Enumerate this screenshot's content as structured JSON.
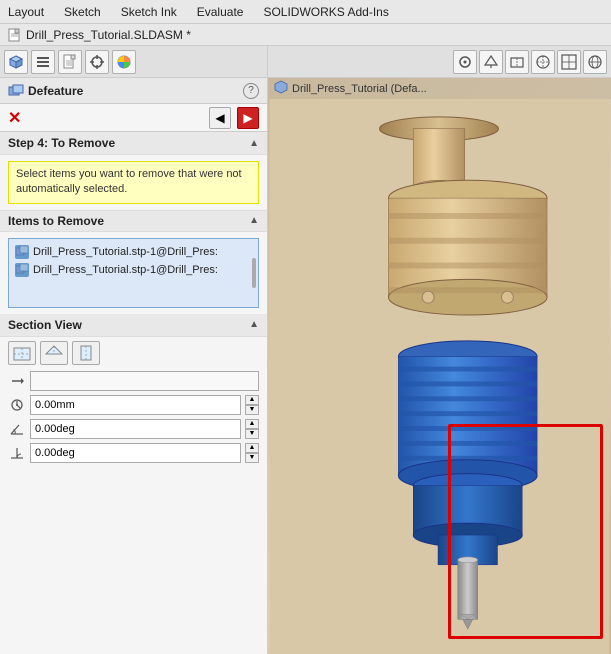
{
  "menubar": {
    "items": [
      "Layout",
      "Sketch",
      "Sketch Ink",
      "Evaluate",
      "SOLIDWORKS Add-Ins"
    ]
  },
  "titlebar": {
    "filename": "Drill_Press_Tutorial.SLDASM *"
  },
  "toolbar": {
    "buttons": [
      "cube-icon",
      "list-icon",
      "doc-icon",
      "crosshair-icon",
      "color-icon"
    ]
  },
  "right_toolbar": {
    "buttons": [
      "view1",
      "view2",
      "view3",
      "view4",
      "view5",
      "view6"
    ]
  },
  "right_title": {
    "label": "Drill_Press_Tutorial (Defa..."
  },
  "panel": {
    "title": "Defeature",
    "help_label": "?",
    "close_label": "✕",
    "nav_back_label": "◀",
    "nav_fwd_label": "▶"
  },
  "step4": {
    "title": "Step 4: To Remove",
    "info_text": "Select items you want to remove that were not automatically selected."
  },
  "items_to_remove": {
    "title": "Items to Remove",
    "items": [
      "Drill_Press_Tutorial.stp-1@Drill_Pres:",
      "Drill_Press_Tutorial.stp-1@Drill_Pres:"
    ]
  },
  "section_view": {
    "title": "Section View",
    "icons": [
      "section-front-icon",
      "section-top-icon",
      "section-right-icon"
    ],
    "rows": [
      {
        "icon": "arrow-icon",
        "value": "",
        "placeholder": ""
      },
      {
        "icon": "distance-icon",
        "value": "0.00mm",
        "placeholder": "0.00mm"
      },
      {
        "icon": "angle1-icon",
        "value": "0.00deg",
        "placeholder": "0.00deg"
      },
      {
        "icon": "angle2-icon",
        "value": "0.00deg",
        "placeholder": "0.00deg"
      }
    ]
  },
  "colors": {
    "accent_red": "#cc2222",
    "highlight_border": "#dd0000",
    "info_bg": "#ffffc0",
    "list_bg": "#dce8f8",
    "list_border": "#7aa8d8"
  }
}
